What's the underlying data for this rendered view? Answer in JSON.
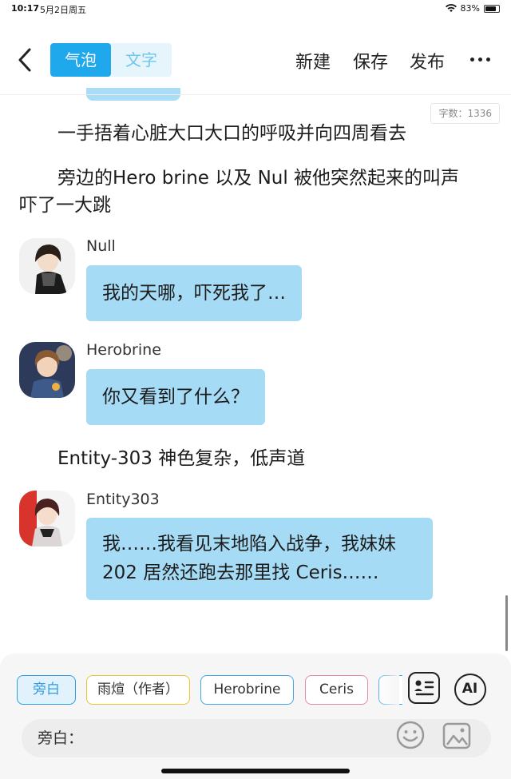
{
  "status_bar": {
    "time": "10:17",
    "date": "5月2日周五",
    "battery": "83%",
    "battery_level": 0.83
  },
  "toolbar": {
    "tabs": [
      {
        "label": "气泡",
        "active": true
      },
      {
        "label": "文字",
        "active": false
      }
    ],
    "new_label": "新建",
    "save_label": "保存",
    "publish_label": "发布"
  },
  "word_count": "字数：1336",
  "content": {
    "narration_1": "一手捂着心脏大口大口的呼吸并向四周看去",
    "narration_2_line1": "旁边的Hero brine 以及 Nul 被他突然起来的叫声",
    "narration_2_line2": "吓了一大跳",
    "messages": [
      {
        "speaker": "Null",
        "text": "我的天哪，吓死我了…"
      },
      {
        "speaker": "Herobrine",
        "text": "你又看到了什么？"
      },
      {
        "speaker": "Entity303",
        "line1": "我……我看见末地陷入战争，我妹妹",
        "line2": "202 居然还跑去那里找 Ceris……"
      }
    ],
    "narration_3": "Entity-303 神色复杂，低声道"
  },
  "characters": [
    {
      "label": "旁白",
      "color": "#2d9ee0",
      "selected": true
    },
    {
      "label": "雨煊（作者）",
      "color": "#e8c530",
      "selected": false
    },
    {
      "label": "Herobrine",
      "color": "#40a8e6",
      "selected": false
    },
    {
      "label": "Ceris",
      "color": "#e68aa0",
      "selected": false
    }
  ],
  "ai_label": "AI",
  "input": {
    "prefix": "旁白：",
    "value": ""
  },
  "colors": {
    "accent": "#1fa8ec",
    "bubble": "#a6dbf6",
    "tab_bg": "#e6f5fc"
  }
}
